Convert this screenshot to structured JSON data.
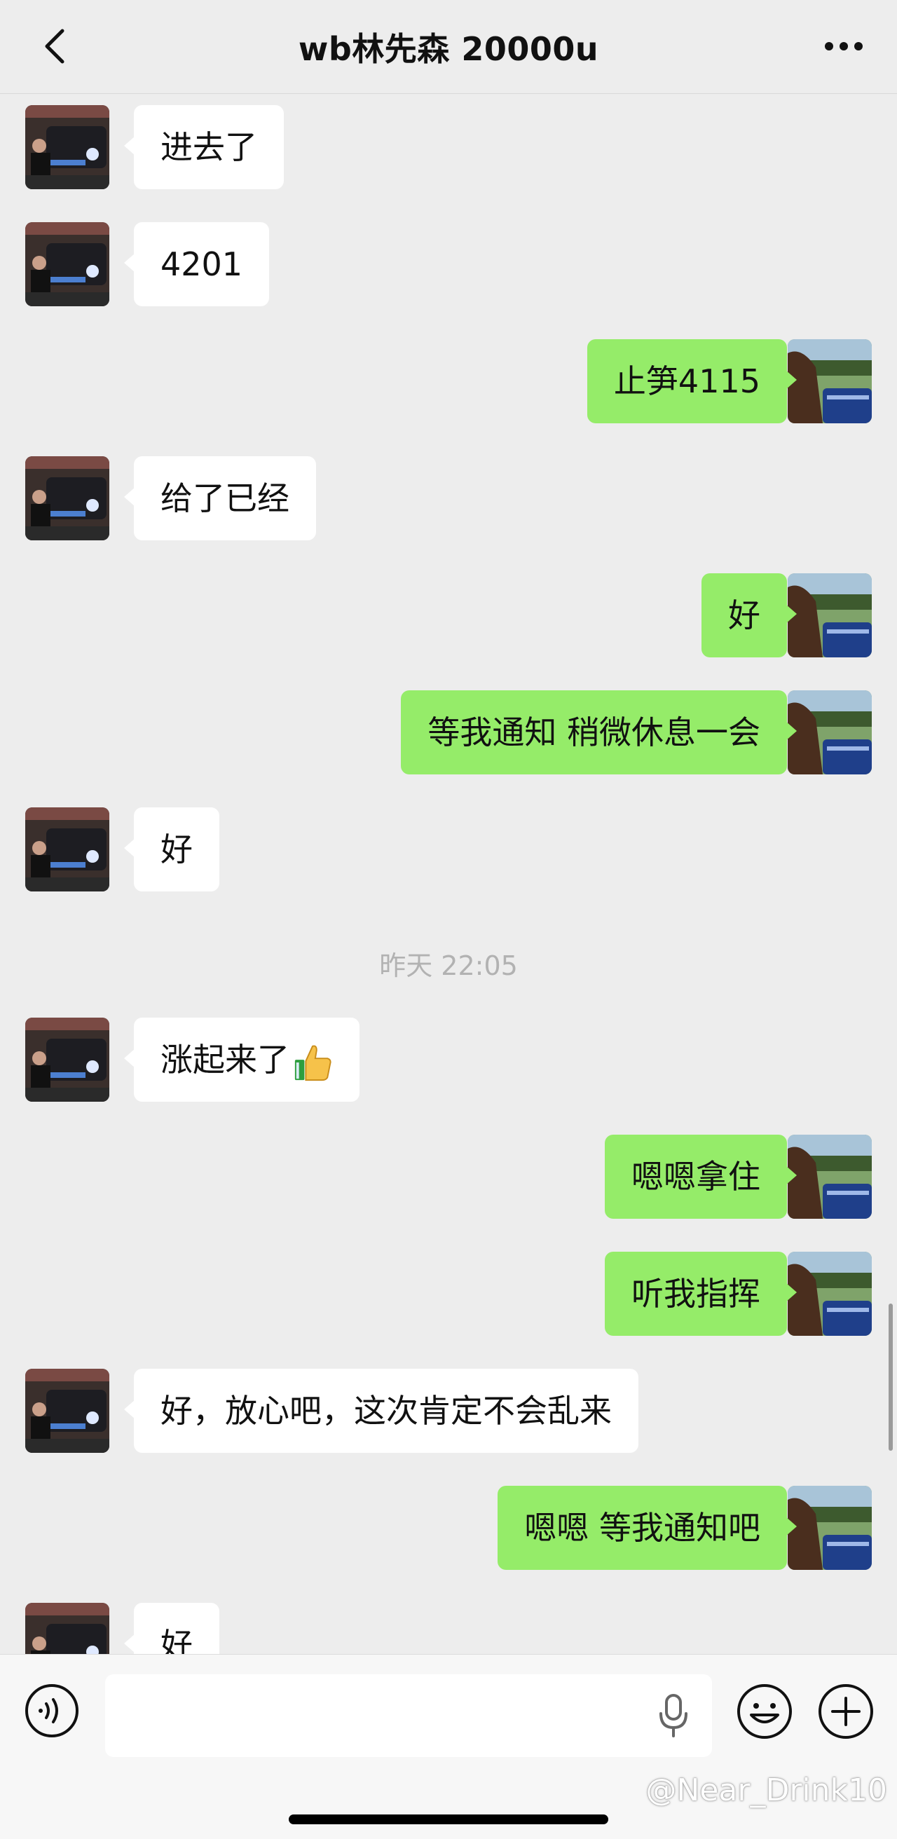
{
  "header": {
    "title": "wb林先森 20000u"
  },
  "messages": [
    {
      "side": "left",
      "text": "进去了"
    },
    {
      "side": "left",
      "text": "4201"
    },
    {
      "side": "right",
      "text": "止笋4115"
    },
    {
      "side": "left",
      "text": "给了已经"
    },
    {
      "side": "right",
      "text": "好"
    },
    {
      "side": "right",
      "text": "等我通知 稍微休息一会"
    },
    {
      "side": "left",
      "text": "好"
    },
    {
      "side": "left",
      "text": "涨起来了"
    },
    {
      "side": "right",
      "text": "嗯嗯拿住"
    },
    {
      "side": "right",
      "text": "听我指挥"
    },
    {
      "side": "left",
      "text": "好，放心吧，这次肯定不会乱来"
    },
    {
      "side": "right",
      "text": "嗯嗯 等我通知吧"
    },
    {
      "side": "left",
      "text": "好"
    }
  ],
  "timestamp": "昨天 22:05",
  "input": {
    "value": "",
    "placeholder": ""
  },
  "watermark": "@Near_Drink10",
  "icons": {
    "back": "chevron-left-icon",
    "more": "more-dots-icon",
    "voice": "voice-icon",
    "mic": "mic-icon",
    "emoji": "emoji-icon",
    "plus": "plus-icon",
    "thumbs_up": "thumbs-up-emoji"
  },
  "colors": {
    "self_bubble": "#95ec69",
    "other_bubble": "#ffffff",
    "background": "#ededed"
  }
}
